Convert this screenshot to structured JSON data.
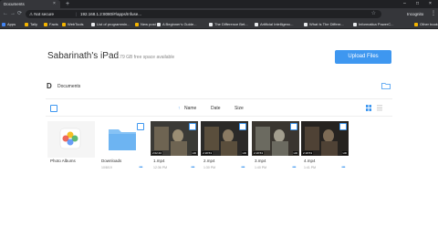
{
  "browser": {
    "tab_title": "Documents",
    "tab_close": "×",
    "new_tab": "+",
    "window_controls": [
      "–",
      "□",
      "×"
    ],
    "nav": {
      "back": "←",
      "forward": "→",
      "reload": "⟳"
    },
    "security_warning": "Not secure",
    "url": "192.168.1.2:8080/#/apps/Infuse...",
    "incognito_label": "Incognito",
    "menu": "⋮",
    "bookmarks": [
      {
        "label": "Apps",
        "color": "#4285f4"
      },
      {
        "label": "Tally",
        "color": "#f4b400"
      },
      {
        "label": "Facts",
        "color": "#f4b400"
      },
      {
        "label": "WebTools",
        "color": "#f4b400"
      },
      {
        "label": "List of programmin...",
        "color": "#e8eaed"
      },
      {
        "label": "New post",
        "color": "#f4b400"
      },
      {
        "label": "A Beginner's Guide...",
        "color": "#e8eaed"
      },
      {
        "label": "The Difference Bet...",
        "color": "#e8eaed"
      },
      {
        "label": "Artificial Intelligenc...",
        "color": "#e8eaed"
      },
      {
        "label": "What Is The Differe...",
        "color": "#e8eaed"
      },
      {
        "label": "Informatica PowerC...",
        "color": "#e8eaed"
      },
      {
        "label": "Other bookm",
        "color": "#f4b400"
      }
    ]
  },
  "header": {
    "device_name": "Sabarinath's iPad",
    "free_space": "7.79 GB free space available",
    "upload_label": "Upload Files"
  },
  "section": {
    "icon_letter": "D",
    "title": "Documents"
  },
  "sortbar": {
    "arrow": "↑",
    "name": "Name",
    "date": "Date",
    "size": "Size"
  },
  "items": [
    {
      "name": "Photo Albums",
      "date": "",
      "type": "albums"
    },
    {
      "name": "Downloads",
      "date": "10/8/19",
      "type": "folder"
    },
    {
      "name": "1.mp4",
      "date": "12:36 PM",
      "type": "video",
      "duration": "2:02:40",
      "badge": "HD"
    },
    {
      "name": "2.mp4",
      "date": "1:30 PM",
      "type": "video",
      "duration": "2:18:53",
      "badge": "HD"
    },
    {
      "name": "3.mp4",
      "date": "1:40 PM",
      "type": "video",
      "duration": "2:18:53",
      "badge": "HD"
    },
    {
      "name": "4.mp4",
      "date": "1:41 PM",
      "type": "video",
      "duration": "2:18:53",
      "badge": "HD"
    }
  ],
  "more_glyph": "•••",
  "colors": {
    "accent": "#3e97f0",
    "chrome_dark": "#202124",
    "chrome": "#35363a"
  }
}
